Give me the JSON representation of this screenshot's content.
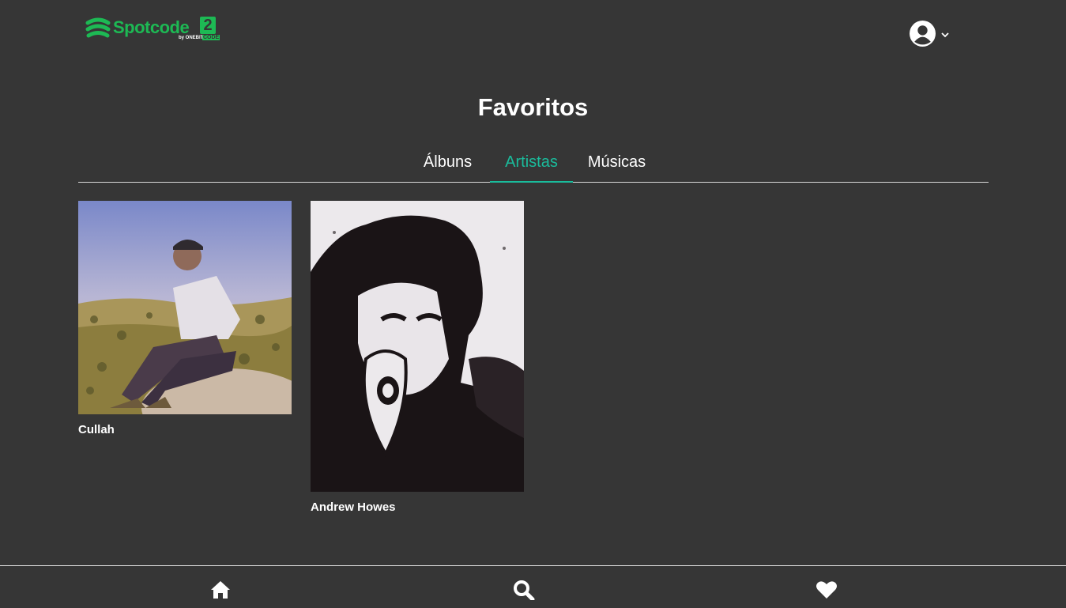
{
  "header": {
    "logo": {
      "name": "Spotcode",
      "version": "2",
      "by": "by ONEBIT",
      "code": "CODE"
    },
    "user_menu": {
      "avatar_icon": "user-circle-icon",
      "caret_icon": "chevron-down-icon"
    }
  },
  "page": {
    "title": "Favoritos"
  },
  "tabs": [
    {
      "label": "Álbuns",
      "active": false
    },
    {
      "label": "Artistas",
      "active": true
    },
    {
      "label": "Músicas",
      "active": false
    }
  ],
  "artists": [
    {
      "name": "Cullah"
    },
    {
      "name": "Andrew Howes"
    }
  ],
  "bottom_nav": [
    {
      "icon": "home-icon"
    },
    {
      "icon": "search-icon"
    },
    {
      "icon": "heart-icon"
    }
  ],
  "colors": {
    "background": "#363636",
    "accent": "#1abc9c",
    "brand": "#1db954"
  }
}
